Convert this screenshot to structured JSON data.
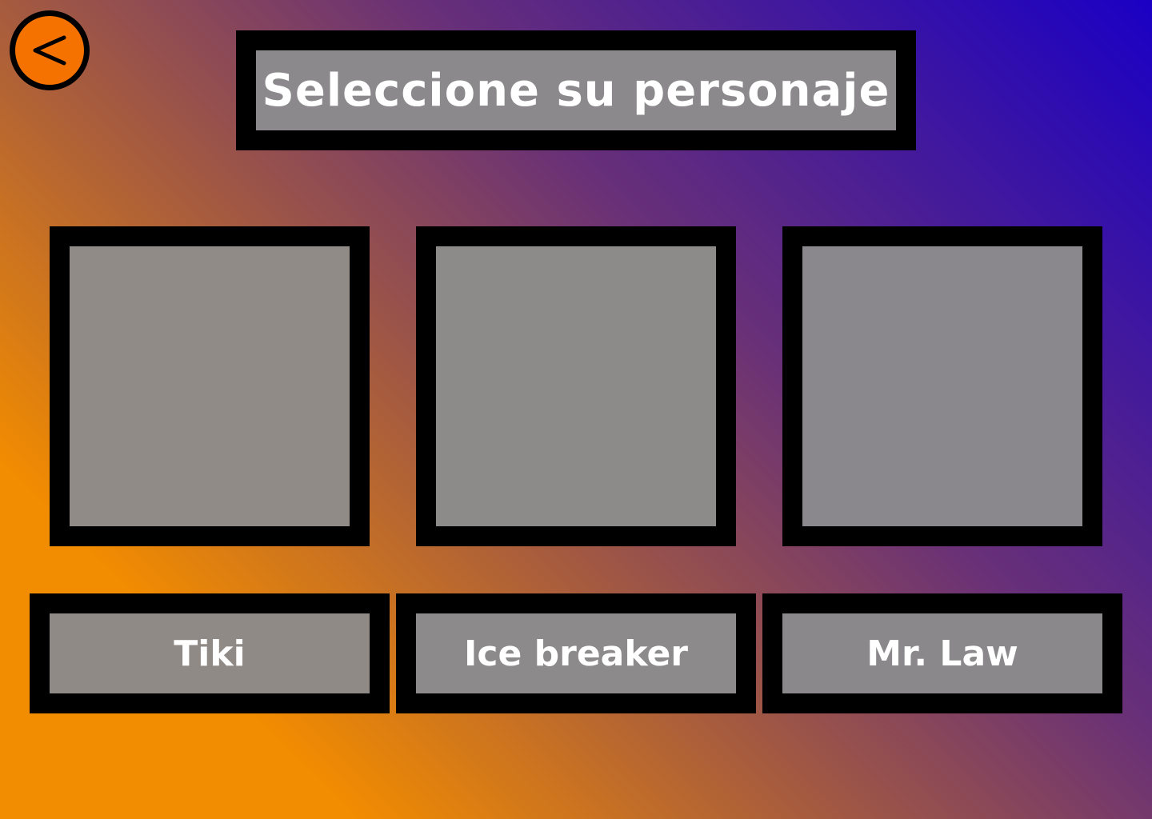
{
  "header": {
    "title": "Seleccione su personaje",
    "back_icon": "chevron-left-icon"
  },
  "characters": [
    {
      "name": "Tiki"
    },
    {
      "name": "Ice breaker"
    },
    {
      "name": "Mr. Law"
    }
  ],
  "colors": {
    "back_button": "#f57200",
    "frame_border": "#000000",
    "panel_fill": "#8b898b",
    "text": "#ffffff",
    "gradient_start": "#f28c00",
    "gradient_end": "#1a00c4"
  }
}
